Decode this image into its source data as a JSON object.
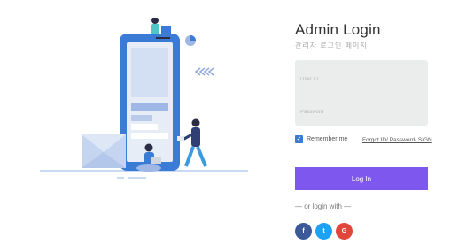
{
  "login": {
    "title": "Admin Login",
    "subtitle": "관리자 로그인 페이지",
    "user_id_placeholder": "User ID",
    "password_placeholder": "Password",
    "remember_label": "Remember me",
    "forgot_link": "Forgot ID/ Password/ SIGN",
    "login_button": "Log In",
    "or_text": "— or login with —",
    "social": {
      "facebook": "f",
      "twitter": "t",
      "google": "G"
    }
  },
  "colors": {
    "accent": "#7d57ee",
    "facebook": "#3b5998",
    "twitter": "#1da1f2",
    "google": "#e0463b",
    "illustration_blue": "#3a7bd5"
  },
  "icons": [
    "phone-illustration",
    "person-laptop-illustration",
    "pie-chart-icon",
    "arrows-icon",
    "envelope-illustration",
    "check-icon"
  ]
}
